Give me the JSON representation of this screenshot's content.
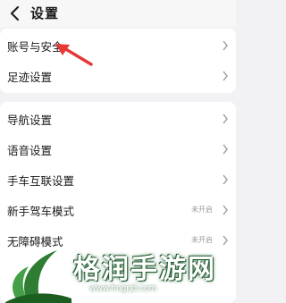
{
  "header": {
    "title": "设置",
    "back_icon": "chevron-left-icon"
  },
  "groups": [
    {
      "items": [
        {
          "label": "账号与安全",
          "status": ""
        },
        {
          "label": "足迹设置",
          "status": ""
        }
      ]
    },
    {
      "items": [
        {
          "label": "导航设置",
          "status": ""
        },
        {
          "label": "语音设置",
          "status": ""
        },
        {
          "label": "手车互联设置",
          "status": ""
        },
        {
          "label": "新手驾车模式",
          "status": "未开启"
        },
        {
          "label": "无障碍模式",
          "status": "未开启"
        }
      ]
    }
  ],
  "annotation": {
    "icon": "red-arrow-icon",
    "color": "#e53935"
  },
  "watermark": {
    "text": "格润手游网",
    "url": "www.hngrjd.com",
    "color": "#2e7d32"
  }
}
